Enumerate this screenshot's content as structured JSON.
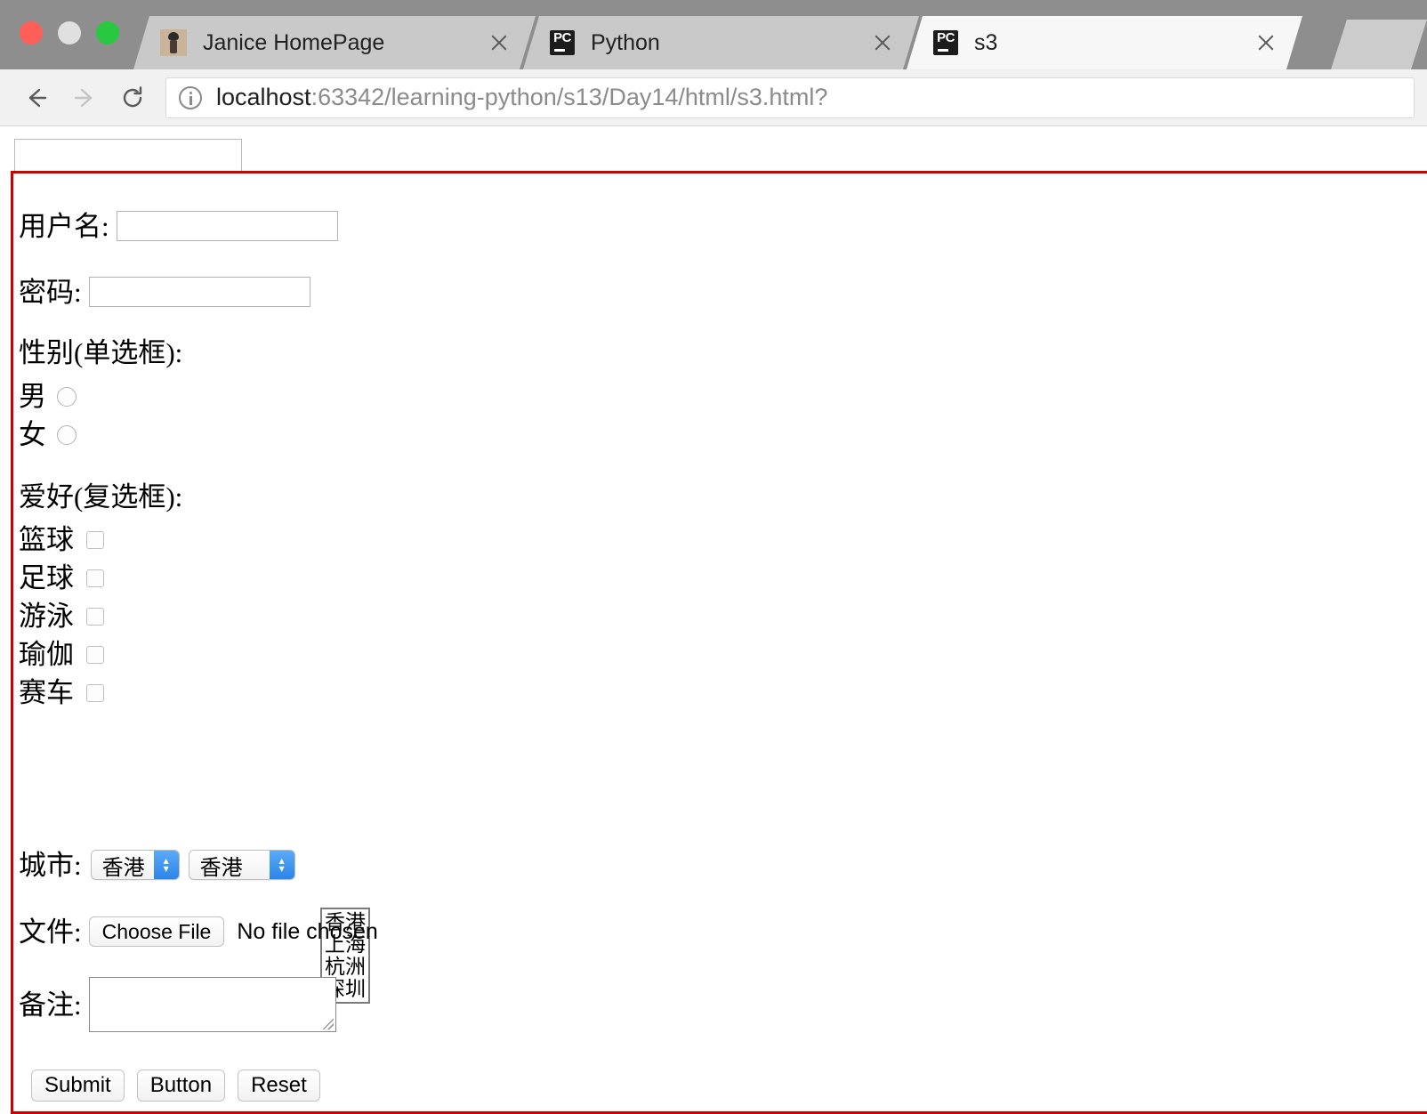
{
  "window": {
    "traffic_lights": [
      "close",
      "minimize",
      "maximize"
    ]
  },
  "tabs": [
    {
      "title": "Janice HomePage",
      "favicon": "avatar-icon",
      "active": false
    },
    {
      "title": "Python",
      "favicon": "pycharm-icon",
      "active": false
    },
    {
      "title": "s3",
      "favicon": "pycharm-icon",
      "active": true
    }
  ],
  "toolbar": {
    "back_icon": "arrow-left-icon",
    "forward_icon": "arrow-right-icon",
    "reload_icon": "reload-icon",
    "security_icon": "info-circle-icon",
    "url_host": "localhost",
    "url_rest": ":63342/learning-python/s13/Day14/html/s3.html?"
  },
  "page": {
    "top_input_value": "",
    "form": {
      "username": {
        "label": "用户名:",
        "value": ""
      },
      "password": {
        "label": "密码:",
        "value": ""
      },
      "gender": {
        "label": "性别(单选框):",
        "options": [
          {
            "label": "男",
            "checked": false
          },
          {
            "label": "女",
            "checked": false
          }
        ]
      },
      "hobby": {
        "label": "爱好(复选框):",
        "options": [
          {
            "label": "篮球",
            "checked": false
          },
          {
            "label": "足球",
            "checked": false
          },
          {
            "label": "游泳",
            "checked": false
          },
          {
            "label": "瑜伽",
            "checked": false
          },
          {
            "label": "赛车",
            "checked": false
          }
        ]
      },
      "city": {
        "label": "城市:",
        "select_one_value": "香港",
        "select_two_value": "香港",
        "listbox_options": [
          "香港",
          "上海",
          "杭洲",
          "深圳"
        ]
      },
      "file": {
        "label": "文件:",
        "button_label": "Choose File",
        "status": "No file chosen"
      },
      "remark": {
        "label": "备注:",
        "value": ""
      },
      "buttons": [
        {
          "label": "Submit"
        },
        {
          "label": "Button"
        },
        {
          "label": "Reset"
        }
      ]
    }
  },
  "colors": {
    "form_border": "#cc0000",
    "stepper_blue": "#2b85e8",
    "tab_active_bg": "#f7f7f7",
    "tabstrip_bg": "#8e8e8e"
  }
}
